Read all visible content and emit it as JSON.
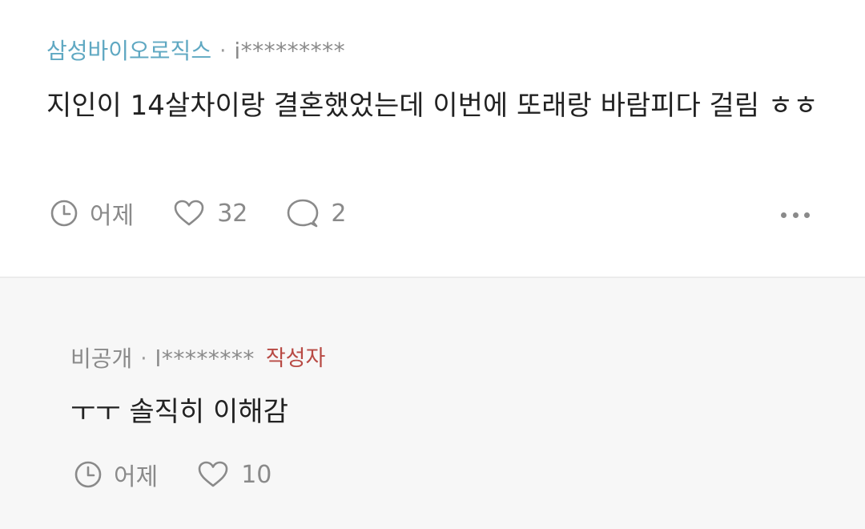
{
  "post": {
    "company": "삼성바이오로직스",
    "separator": "·",
    "author": "i*********",
    "content": "지인이 14살차이랑 결혼했었는데 이번에 또래랑 바람피다 걸림 ㅎㅎ",
    "time": "어제",
    "likes": "32",
    "comments": "2",
    "icons": {
      "time": "clock-icon",
      "like": "heart-icon",
      "comment": "speech-bubble-icon",
      "more": "more-icon"
    }
  },
  "reply": {
    "company": "비공개",
    "separator": "·",
    "author": "l********",
    "badge": "작성자",
    "content": "ㅜㅜ 솔직히 이해감",
    "time": "어제",
    "likes": "10"
  },
  "colors": {
    "company": "#5fa8c2",
    "badge": "#b84a44",
    "text": "#222222",
    "meta": "#8a8a8a",
    "reply_background": "#f7f7f7"
  }
}
